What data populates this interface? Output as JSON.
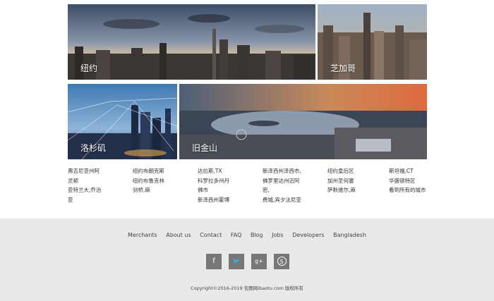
{
  "tiles": [
    {
      "label": "纽约"
    },
    {
      "label": "芝加哥"
    },
    {
      "label": "洛杉矶"
    },
    {
      "label": "旧金山"
    }
  ],
  "link_columns": [
    {
      "items": [
        "弗吉尼亚州阿",
        "灵顿",
        "亚特兰大,乔治",
        "亚"
      ]
    },
    {
      "items": [
        "纽约布朗克斯",
        "纽约布鲁克林",
        "剑桥,麻"
      ]
    },
    {
      "items": [
        "达拉斯,TX",
        "科罗拉多州丹",
        "佛市",
        "新泽西州霍博"
      ]
    },
    {
      "items": [
        "新泽西州泽西市,",
        "佛罗里达州迈阿",
        "密,",
        "费城,宾夕法尼亚"
      ]
    },
    {
      "items": [
        "纽约皇后区",
        "加州圣何塞",
        "萨默维尔,麻"
      ]
    },
    {
      "items": [
        "斯坦福,CT",
        "华盛顿特区",
        "看到所有的城市"
      ]
    }
  ],
  "footer": {
    "nav": [
      "Merchants",
      "About us",
      "Contact",
      "FAQ",
      "Blog",
      "Jobs",
      "Developers",
      "Bangladesh"
    ],
    "social": [
      {
        "glyph": "f",
        "icon": "facebook-icon"
      },
      {
        "glyph": "🐦",
        "icon": "twitter-icon"
      },
      {
        "glyph": "g+",
        "icon": "google-plus-icon"
      },
      {
        "glyph": "S",
        "icon": "skype-icon"
      }
    ],
    "copyright": "Copyright©2016-2019 包图网ibaotu.com 版权所有"
  }
}
